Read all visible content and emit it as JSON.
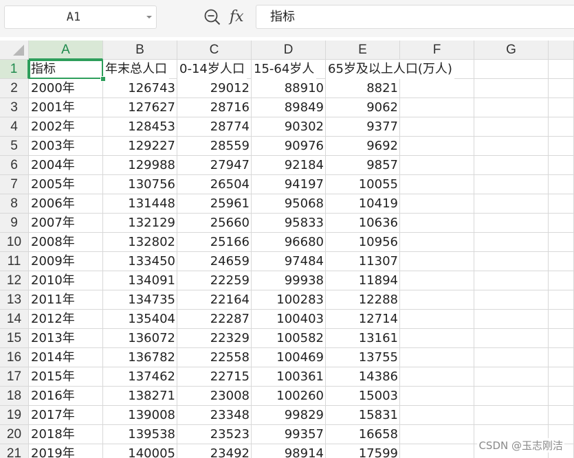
{
  "formula_bar": {
    "name_box": "A1",
    "formula_value": "指标"
  },
  "columns": [
    "A",
    "B",
    "C",
    "D",
    "E",
    "F",
    "G"
  ],
  "rows": [
    "1",
    "2",
    "3",
    "4",
    "5",
    "6",
    "7",
    "8",
    "9",
    "10",
    "11",
    "12",
    "13",
    "14",
    "15",
    "16",
    "17",
    "18",
    "19",
    "20",
    "21"
  ],
  "header_row": [
    "指标",
    "年末总人口",
    "0-14岁人口",
    "15-64岁人",
    "65岁及以上人口(万人)"
  ],
  "table": [
    [
      "2000年",
      "126743",
      "29012",
      "88910",
      "8821"
    ],
    [
      "2001年",
      "127627",
      "28716",
      "89849",
      "9062"
    ],
    [
      "2002年",
      "128453",
      "28774",
      "90302",
      "9377"
    ],
    [
      "2003年",
      "129227",
      "28559",
      "90976",
      "9692"
    ],
    [
      "2004年",
      "129988",
      "27947",
      "92184",
      "9857"
    ],
    [
      "2005年",
      "130756",
      "26504",
      "94197",
      "10055"
    ],
    [
      "2006年",
      "131448",
      "25961",
      "95068",
      "10419"
    ],
    [
      "2007年",
      "132129",
      "25660",
      "95833",
      "10636"
    ],
    [
      "2008年",
      "132802",
      "25166",
      "96680",
      "10956"
    ],
    [
      "2009年",
      "133450",
      "24659",
      "97484",
      "11307"
    ],
    [
      "2010年",
      "134091",
      "22259",
      "99938",
      "11894"
    ],
    [
      "2011年",
      "134735",
      "22164",
      "100283",
      "12288"
    ],
    [
      "2012年",
      "135404",
      "22287",
      "100403",
      "12714"
    ],
    [
      "2013年",
      "136072",
      "22329",
      "100582",
      "13161"
    ],
    [
      "2014年",
      "136782",
      "22558",
      "100469",
      "13755"
    ],
    [
      "2015年",
      "137462",
      "22715",
      "100361",
      "14386"
    ],
    [
      "2016年",
      "138271",
      "23008",
      "100260",
      "15003"
    ],
    [
      "2017年",
      "139008",
      "23348",
      "99829",
      "15831"
    ],
    [
      "2018年",
      "139538",
      "23523",
      "99357",
      "16658"
    ],
    [
      "2019年",
      "140005",
      "23492",
      "98914",
      "17599"
    ]
  ],
  "watermark": "CSDN @玉志刚洁",
  "colors": {
    "accent": "#2e9e5b",
    "header_bg": "#f0f0f0",
    "active_header_bg": "#d9e8d6",
    "grid_line": "#d8d8d8"
  },
  "icons": {
    "zoom": "zoom-out-magnifier-icon",
    "function": "fx-icon",
    "dropdown": "chevron-down-icon",
    "select_all": "select-all-triangle-icon"
  }
}
